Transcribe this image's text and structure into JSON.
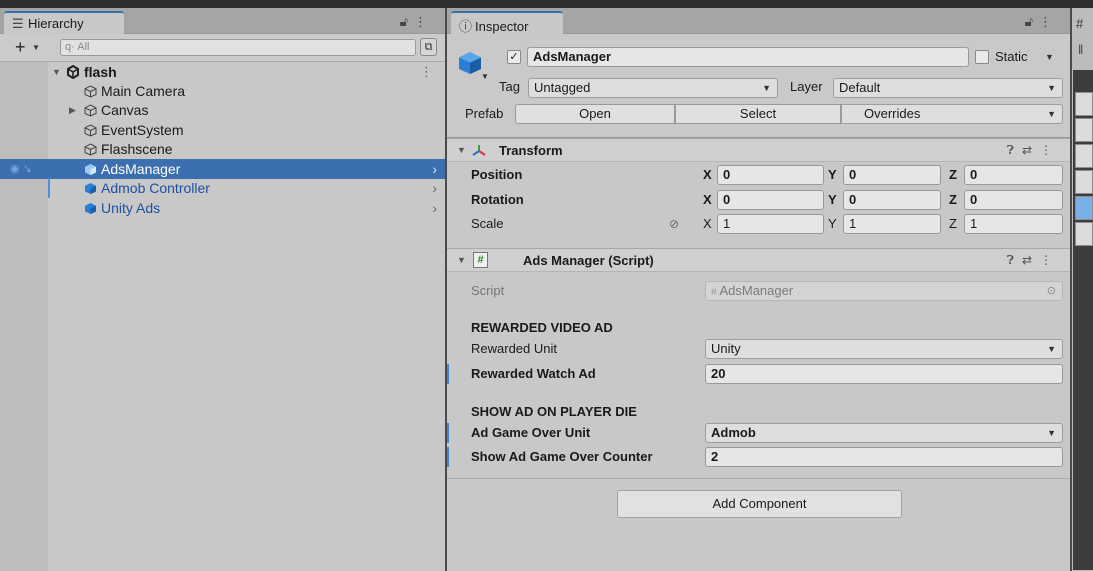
{
  "hierarchy": {
    "tab_label": "Hierarchy",
    "search_placeholder": "All",
    "search_prefix": "q·",
    "scene_name": "flash",
    "items": [
      {
        "label": "Main Camera"
      },
      {
        "label": "Canvas"
      },
      {
        "label": "EventSystem"
      },
      {
        "label": "Flashscene"
      },
      {
        "label": "AdsManager"
      },
      {
        "label": "Admob Controller"
      },
      {
        "label": "Unity Ads"
      }
    ]
  },
  "inspector": {
    "tab_label": "Inspector",
    "object_name": "AdsManager",
    "static_label": "Static",
    "tag_label": "Tag",
    "tag_value": "Untagged",
    "layer_label": "Layer",
    "layer_value": "Default",
    "prefab_label": "Prefab",
    "prefab_open": "Open",
    "prefab_select": "Select",
    "prefab_overrides": "Overrides",
    "transform": {
      "title": "Transform",
      "position_label": "Position",
      "rotation_label": "Rotation",
      "scale_label": "Scale",
      "position": {
        "x": "0",
        "y": "0",
        "z": "0"
      },
      "rotation": {
        "x": "0",
        "y": "0",
        "z": "0"
      },
      "scale": {
        "x": "1",
        "y": "1",
        "z": "1"
      },
      "axis_x": "X",
      "axis_y": "Y",
      "axis_z": "Z"
    },
    "script_component": {
      "title": "Ads Manager (Script)",
      "script_label": "Script",
      "script_value": "AdsManager",
      "rewarded_header": "REWARDED VIDEO AD",
      "rewarded_unit_label": "Rewarded Unit",
      "rewarded_unit_value": "Unity",
      "rewarded_watch_label": "Rewarded Watch Ad",
      "rewarded_watch_value": "20",
      "player_die_header": "SHOW AD ON PLAYER DIE",
      "game_over_unit_label": "Ad Game Over Unit",
      "game_over_unit_value": "Admob",
      "game_over_counter_label": "Show Ad Game Over Counter",
      "game_over_counter_value": "2"
    },
    "add_component": "Add Component"
  },
  "right_panel": {
    "tab_icon": "#"
  },
  "colors": {
    "selection": "#3c6fb0",
    "prefab_text": "#1f4fa3",
    "prefab_icon": "#2a7fd4"
  }
}
